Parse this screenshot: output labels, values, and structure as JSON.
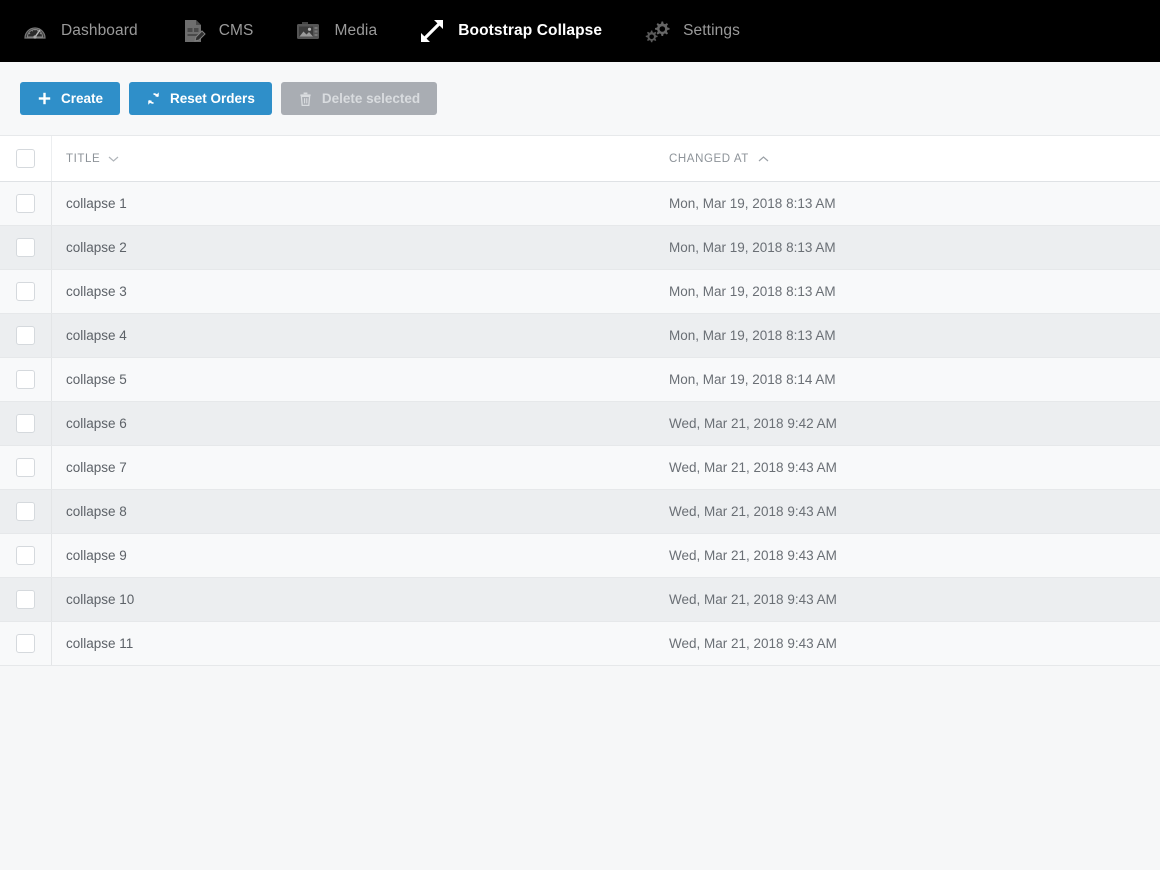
{
  "nav": {
    "items": [
      {
        "label": "Dashboard",
        "icon": "gauge-icon",
        "active": false
      },
      {
        "label": "CMS",
        "icon": "document-pen-icon",
        "active": false
      },
      {
        "label": "Media",
        "icon": "image-camera-icon",
        "active": false
      },
      {
        "label": "Bootstrap Collapse",
        "icon": "expand-arrows-icon",
        "active": true
      },
      {
        "label": "Settings",
        "icon": "gears-icon",
        "active": false
      }
    ]
  },
  "toolbar": {
    "create_label": "Create",
    "create_icon": "plus-icon",
    "reset_label": "Reset Orders",
    "reset_icon": "refresh-icon",
    "delete_label": "Delete selected",
    "delete_icon": "trash-icon",
    "primary_color": "#2f8fc9",
    "disabled_color": "#a9adb3"
  },
  "table": {
    "columns": {
      "title": {
        "label": "TITLE",
        "sort_icon": "chevron-down-icon",
        "sorted": false
      },
      "changed": {
        "label": "CHANGED AT",
        "sort_icon": "chevron-up-icon",
        "sorted": true
      }
    },
    "rows": [
      {
        "title": "collapse 1",
        "changed_at": "Mon, Mar 19, 2018 8:13 AM"
      },
      {
        "title": "collapse 2",
        "changed_at": "Mon, Mar 19, 2018 8:13 AM"
      },
      {
        "title": "collapse 3",
        "changed_at": "Mon, Mar 19, 2018 8:13 AM"
      },
      {
        "title": "collapse 4",
        "changed_at": "Mon, Mar 19, 2018 8:13 AM"
      },
      {
        "title": "collapse 5",
        "changed_at": "Mon, Mar 19, 2018 8:14 AM"
      },
      {
        "title": "collapse 6",
        "changed_at": "Wed, Mar 21, 2018 9:42 AM"
      },
      {
        "title": "collapse 7",
        "changed_at": "Wed, Mar 21, 2018 9:43 AM"
      },
      {
        "title": "collapse 8",
        "changed_at": "Wed, Mar 21, 2018 9:43 AM"
      },
      {
        "title": "collapse 9",
        "changed_at": "Wed, Mar 21, 2018 9:43 AM"
      },
      {
        "title": "collapse 10",
        "changed_at": "Wed, Mar 21, 2018 9:43 AM"
      },
      {
        "title": "collapse 11",
        "changed_at": "Wed, Mar 21, 2018 9:43 AM"
      }
    ]
  }
}
